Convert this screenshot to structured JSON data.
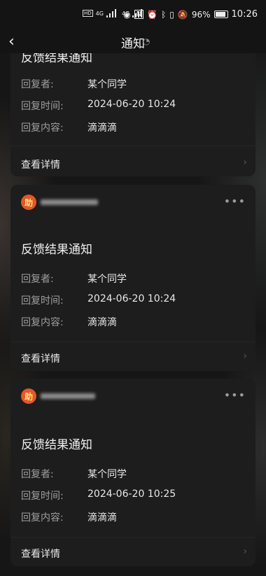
{
  "status": {
    "battery": "96%",
    "time": "10:26",
    "net1": "4G",
    "net2": "4G"
  },
  "nav": {
    "title": "通知"
  },
  "cards": [
    {
      "title": "反馈结果通知",
      "fields": [
        {
          "label": "回复者:",
          "value": "某个同学"
        },
        {
          "label": "回复时间:",
          "value": "2024-06-20 10:24"
        },
        {
          "label": "回复内容:",
          "value": "滴滴滴"
        }
      ],
      "detail": "查看详情"
    },
    {
      "avatar": "助",
      "title": "反馈结果通知",
      "fields": [
        {
          "label": "回复者:",
          "value": "某个同学"
        },
        {
          "label": "回复时间:",
          "value": "2024-06-20 10:24"
        },
        {
          "label": "回复内容:",
          "value": "滴滴滴"
        }
      ],
      "detail": "查看详情"
    },
    {
      "avatar": "助",
      "title": "反馈结果通知",
      "fields": [
        {
          "label": "回复者:",
          "value": "某个同学"
        },
        {
          "label": "回复时间:",
          "value": "2024-06-20 10:25"
        },
        {
          "label": "回复内容:",
          "value": "滴滴滴"
        }
      ],
      "detail": "查看详情"
    }
  ]
}
